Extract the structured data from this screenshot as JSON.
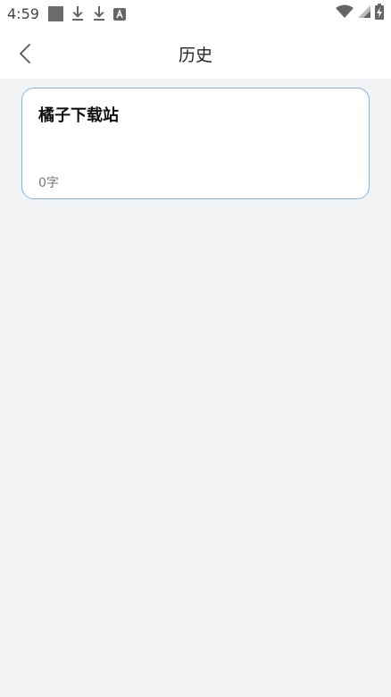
{
  "status_bar": {
    "time": "4:59",
    "icons": [
      "app-square-icon",
      "download-icon",
      "download-icon",
      "font-a-icon",
      "wifi-icon",
      "signal-icon",
      "battery-charging-icon"
    ]
  },
  "header": {
    "back_icon": "chevron-left-icon",
    "title": "历史"
  },
  "history": {
    "items": [
      {
        "title": "橘子下载站",
        "count": "0字"
      }
    ]
  },
  "colors": {
    "background": "#f2f3f5",
    "card_border": "#7fb6e0",
    "header_bg": "#ffffff"
  }
}
